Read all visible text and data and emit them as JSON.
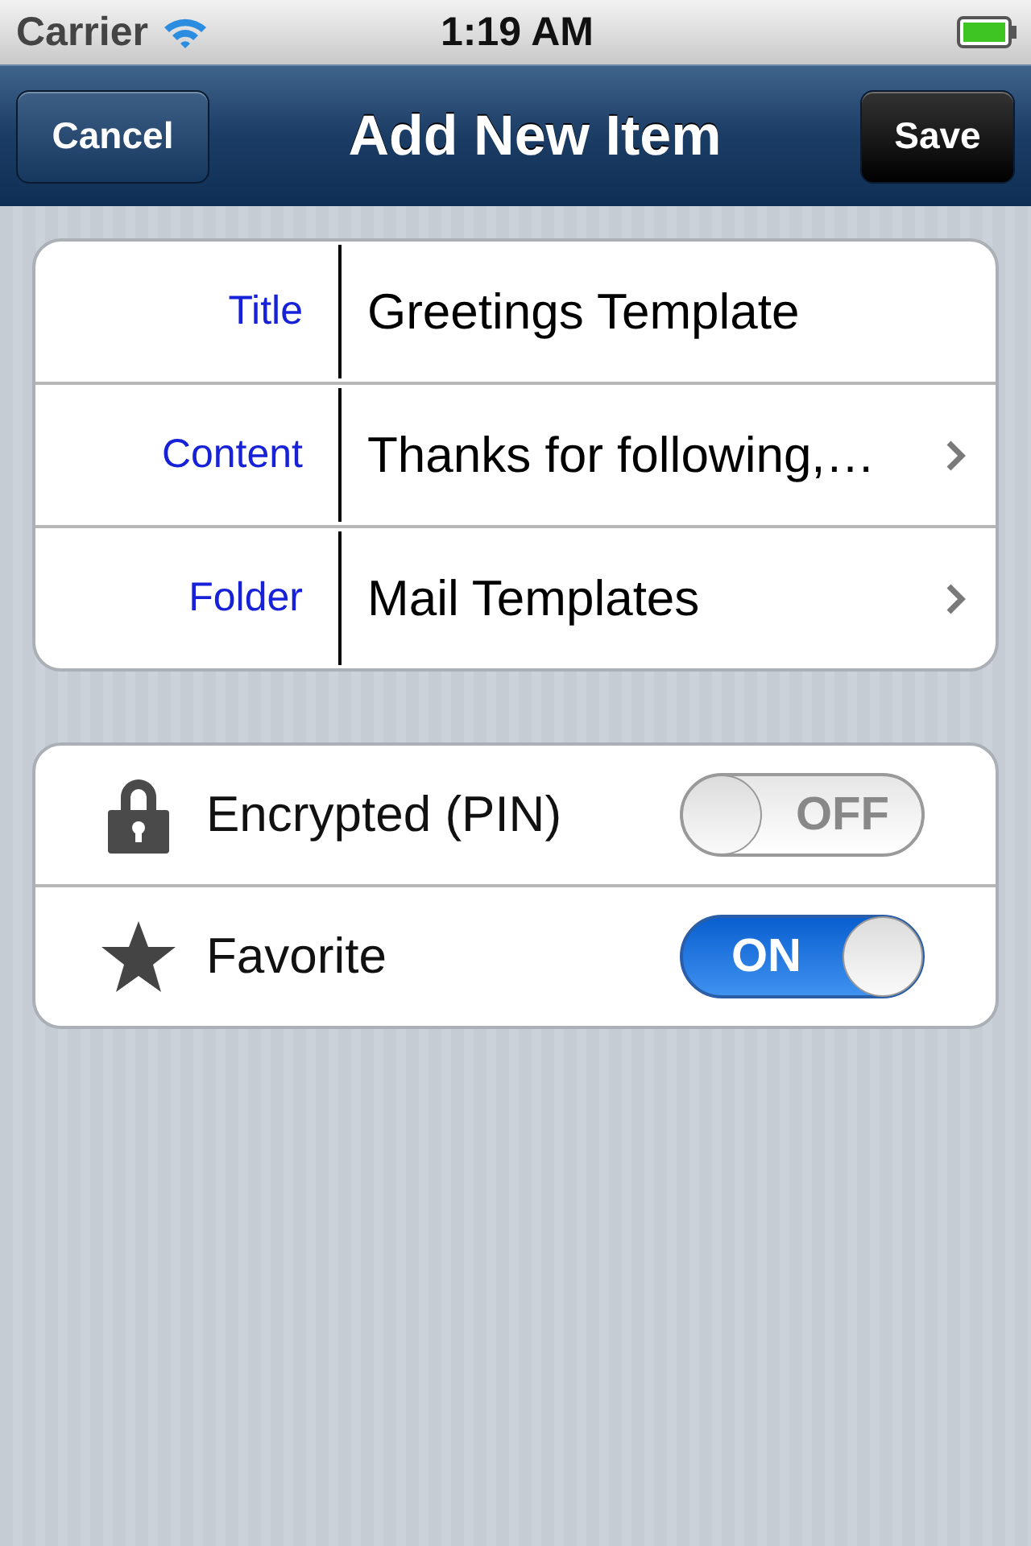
{
  "status_bar": {
    "carrier": "Carrier",
    "time": "1:19 AM"
  },
  "nav_bar": {
    "cancel": "Cancel",
    "title": "Add New Item",
    "save": "Save"
  },
  "fields": [
    {
      "label": "Title",
      "value": "Greetings Template",
      "kind": "text"
    },
    {
      "label": "Content",
      "value": "Thanks for following,…",
      "kind": "disclosure"
    },
    {
      "label": "Folder",
      "value": "Mail Templates",
      "kind": "disclosure"
    }
  ],
  "toggles": [
    {
      "kind": "lock",
      "label": "Encrypted (PIN)",
      "on": false,
      "switch_text": "OFF"
    },
    {
      "kind": "star",
      "label": "Favorite",
      "on": true,
      "switch_text": "ON"
    }
  ]
}
